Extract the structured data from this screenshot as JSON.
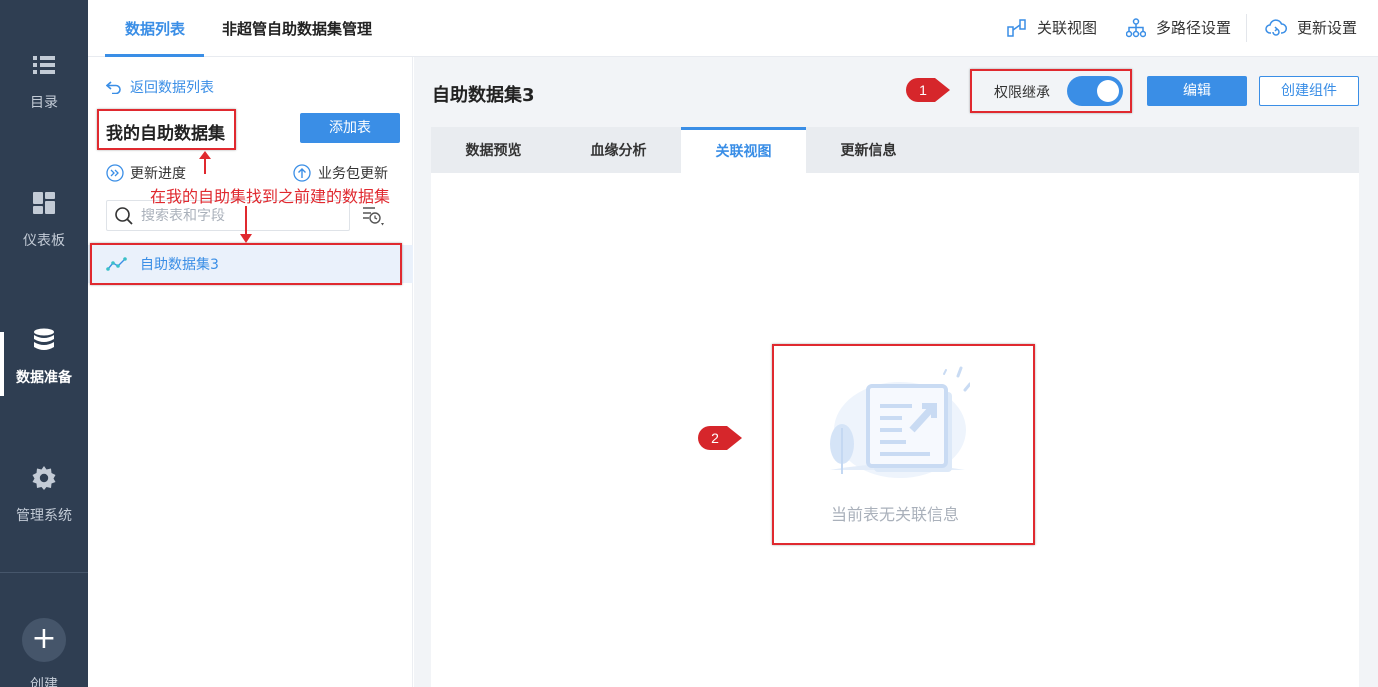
{
  "nav": {
    "items": [
      {
        "label": "目录",
        "icon": "list-icon"
      },
      {
        "label": "仪表板",
        "icon": "dashboard-icon"
      },
      {
        "label": "数据准备",
        "icon": "database-icon"
      },
      {
        "label": "管理系统",
        "icon": "gear-icon"
      }
    ],
    "create": {
      "label": "创建",
      "icon": "plus-icon"
    }
  },
  "topbar": {
    "tabs": [
      {
        "label": "数据列表",
        "active": true
      },
      {
        "label": "非超管自助数据集管理",
        "active": false
      }
    ],
    "actions": [
      {
        "label": "关联视图",
        "icon": "relation-view-icon"
      },
      {
        "label": "多路径设置",
        "icon": "multipath-icon"
      },
      {
        "label": "更新设置",
        "icon": "cloud-refresh-icon"
      }
    ]
  },
  "panel": {
    "back_label": "返回数据列表",
    "title": "我的自助数据集",
    "add_table_label": "添加表",
    "update_progress_label": "更新进度",
    "package_update_label": "业务包更新",
    "search_placeholder": "搜索表和字段",
    "dataset_item": "自助数据集3"
  },
  "main": {
    "title": "自助数据集3",
    "permission_label": "权限继承",
    "permission_on": true,
    "edit_label": "编辑",
    "create_component_label": "创建组件",
    "tabs": [
      {
        "label": "数据预览",
        "active": false
      },
      {
        "label": "血缘分析",
        "active": false
      },
      {
        "label": "关联视图",
        "active": true
      },
      {
        "label": "更新信息",
        "active": false
      }
    ],
    "empty_text": "当前表无关联信息"
  },
  "annotations": {
    "note": "在我的自助集找到之前建的数据集",
    "marker_1": "1",
    "marker_2": "2"
  },
  "colors": {
    "accent": "#3a8ee6",
    "nav_bg": "#2f3e52",
    "annotation_red": "#e0292f"
  }
}
